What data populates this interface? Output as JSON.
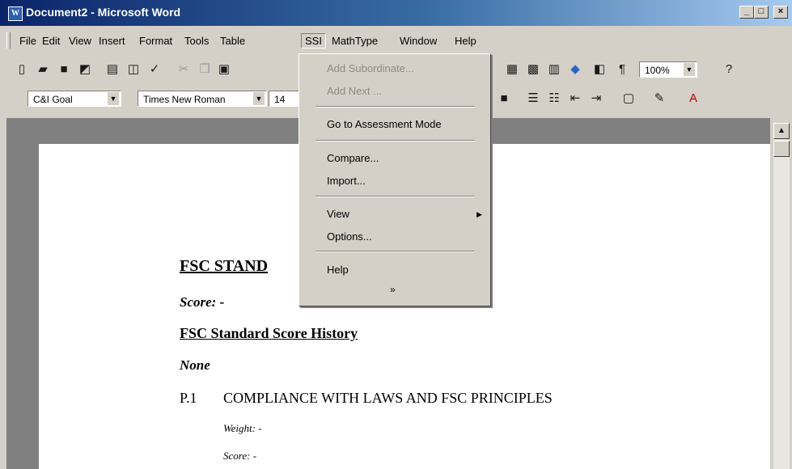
{
  "window": {
    "title": "Document2 - Microsoft Word",
    "app_icon": "W",
    "controls": [
      "_",
      "□",
      "×"
    ]
  },
  "menubar": {
    "items": [
      "File",
      "Edit",
      "View",
      "Insert",
      "Format",
      "Tools",
      "Table",
      "SSI",
      "MathType",
      "Window",
      "Help"
    ],
    "open_item": "SSI"
  },
  "toolbar_standard": {
    "zoom": "100%"
  },
  "toolbar_formatting": {
    "style": "C&I Goal",
    "font": "Times New Roman",
    "size": "14"
  },
  "ssi_menu": {
    "items": [
      {
        "label": "Add Subordinate...",
        "disabled": true
      },
      {
        "label": "Add Next ...",
        "disabled": true
      },
      {
        "label": "Go to Assessment Mode",
        "disabled": false
      },
      {
        "label": "Compare...",
        "disabled": false
      },
      {
        "label": "Import...",
        "disabled": false
      },
      {
        "label": "View",
        "disabled": false,
        "submenu": true
      },
      {
        "label": "Options...",
        "disabled": false
      },
      {
        "label": "Help",
        "disabled": false
      }
    ],
    "expand_glyph": "»"
  },
  "document": {
    "heading": "FSC STAND",
    "score_label": "Score: -",
    "history_heading": "FSC Standard Score History",
    "none_label": "None",
    "principle_number": "P.1",
    "principle_title": "COMPLIANCE WITH LAWS AND FSC PRINCIPLES",
    "weight_label": "Weight: -",
    "sub_score_label": "Score: -"
  }
}
